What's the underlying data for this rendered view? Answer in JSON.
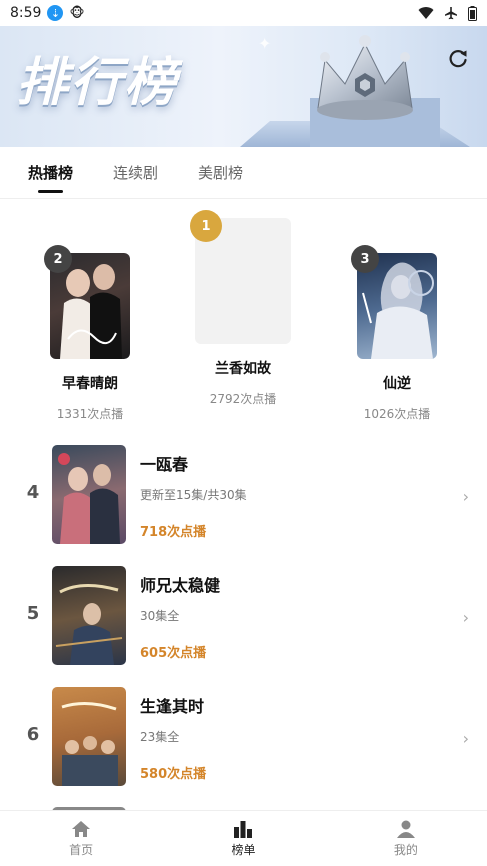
{
  "status_bar": {
    "time": "8:59",
    "download_glyph": "⇣",
    "emoji": "🐵"
  },
  "banner": {
    "title": "排行榜"
  },
  "tabs": [
    {
      "label": "热播榜",
      "active": true
    },
    {
      "label": "连续剧",
      "active": false
    },
    {
      "label": "美剧榜",
      "active": false
    }
  ],
  "podium": [
    {
      "rank": "1",
      "title": "兰香如故",
      "plays": "2792次点播",
      "badge_color": "#d9a73e"
    },
    {
      "rank": "2",
      "title": "早春晴朗",
      "plays": "1331次点播",
      "badge_color": "#444444"
    },
    {
      "rank": "3",
      "title": "仙逆",
      "plays": "1026次点播",
      "badge_color": "#444444"
    }
  ],
  "list": [
    {
      "rank": "4",
      "title": "一瓯春",
      "subtitle": "更新至15集/共30集",
      "plays": "718次点播"
    },
    {
      "rank": "5",
      "title": "师兄太稳健",
      "subtitle": "30集全",
      "plays": "605次点播"
    },
    {
      "rank": "6",
      "title": "生逢其时",
      "subtitle": "23集全",
      "plays": "580次点播"
    }
  ],
  "bottom_nav": [
    {
      "label": "首页",
      "icon": "home-icon",
      "active": false
    },
    {
      "label": "榜单",
      "icon": "chart-icon",
      "active": true
    },
    {
      "label": "我的",
      "icon": "user-icon",
      "active": false
    }
  ],
  "colors": {
    "accent_orange": "#d4852a",
    "gold_badge": "#d9a73e"
  }
}
